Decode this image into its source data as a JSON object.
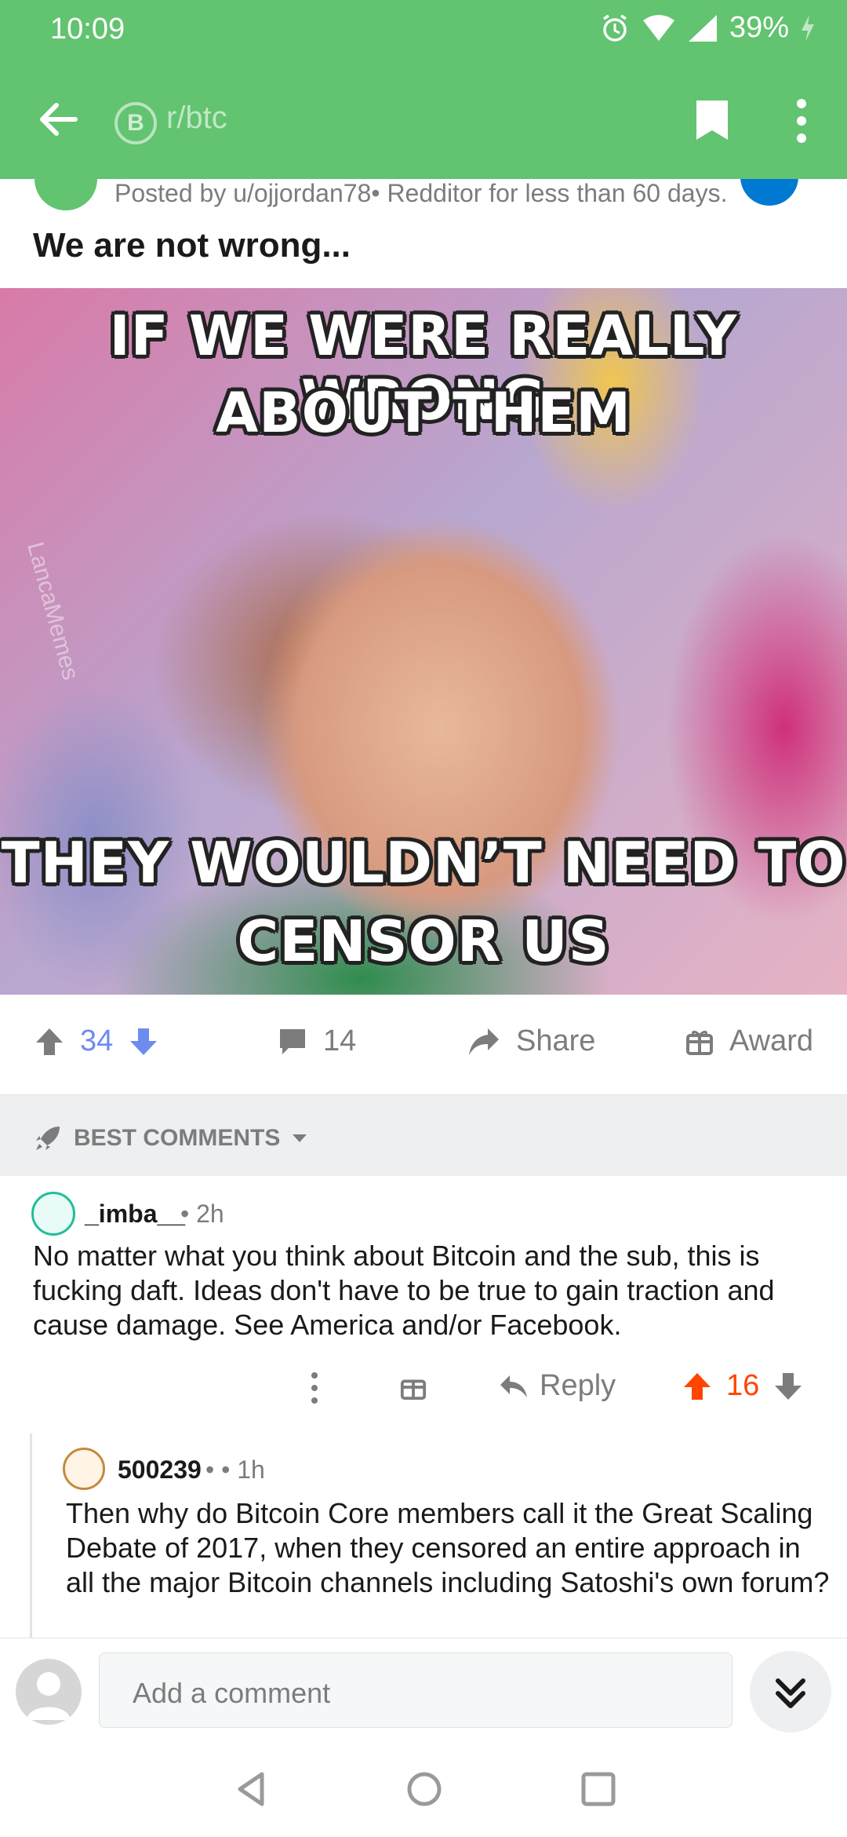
{
  "status_bar": {
    "time": "10:09",
    "battery": "39%"
  },
  "app_bar": {
    "subreddit": "r/btc",
    "subreddit_icon": "B"
  },
  "post": {
    "meta": "Posted by u/ojjordan78• Redditor for less than 60 days.",
    "title": "We are not wrong...",
    "image": {
      "caption_top_1": "IF WE WERE REALLY WRONG",
      "caption_top_2": "ABOUT THEM",
      "caption_bottom_1": "THEY WOULDN’T NEED TO",
      "caption_bottom_2": "CENSOR US",
      "watermark": "LancaMemes"
    },
    "votes": "34",
    "comments": "14",
    "share_label": "Share",
    "award_label": "Award"
  },
  "sort": {
    "label": "BEST COMMENTS"
  },
  "comments": [
    {
      "user": "_imba__",
      "time": "• 2h",
      "body": "No matter what you think about Bitcoin and the sub, this is fucking daft. Ideas don't have to be true to gain traction and cause damage. See America and/or Facebook.",
      "reply_label": "Reply",
      "score": "16"
    },
    {
      "user": "500239",
      "time": "• • 1h",
      "body": "Then why do Bitcoin Core members call it the Great Scaling Debate of 2017, when they censored an entire approach in all the major Bitcoin channels including Satoshi's own forum?"
    }
  ],
  "composer": {
    "placeholder": "Add a comment"
  },
  "colors": {
    "header": "#62c370",
    "upvote": "#ff4500",
    "vote_count": "#6e8cf0",
    "muted": "#7c7c7c"
  }
}
